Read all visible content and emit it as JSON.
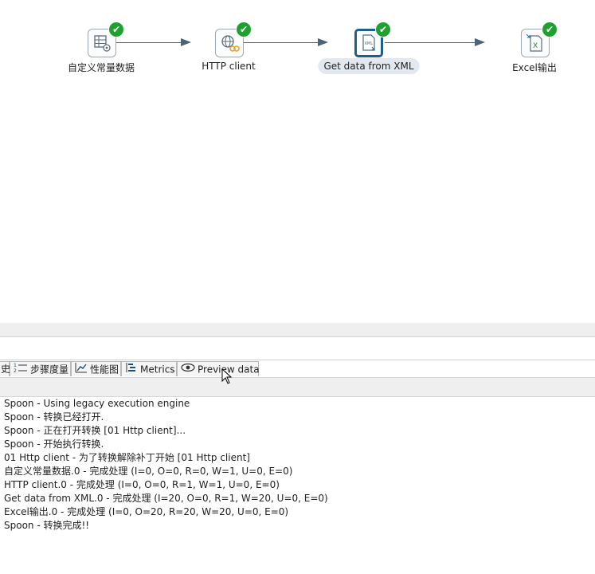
{
  "canvas": {
    "steps": [
      {
        "label": "自定义常量数据",
        "icon": "table-gear-icon"
      },
      {
        "label": "HTTP client",
        "icon": "globe-link-icon"
      },
      {
        "label": "Get data from XML",
        "icon": "xml-file-icon",
        "selected": true
      },
      {
        "label": "Excel输出",
        "icon": "excel-file-icon"
      }
    ],
    "status_icon": "check-icon",
    "colors": {
      "hop": "#4d6477",
      "check": "#1fa12f",
      "selected_border": "#1f5f8b"
    }
  },
  "tabs": {
    "partial_first": "史",
    "step_metrics": "步骤度量",
    "performance_graph": "性能图",
    "metrics": "Metrics",
    "preview_data": "Preview data"
  },
  "log": {
    "lines": [
      "Spoon - Using legacy execution engine",
      "Spoon - 转换已经打开.",
      "Spoon - 正在打开转换 [01 Http client]...",
      "Spoon - 开始执行转换.",
      "01 Http client - 为了转换解除补丁开始  [01 Http client]",
      "自定义常量数据.0 - 完成处理 (I=0, O=0, R=0, W=1, U=0, E=0)",
      "HTTP client.0 - 完成处理 (I=0, O=0, R=1, W=1, U=0, E=0)",
      "Get data from XML.0 - 完成处理 (I=20, O=0, R=1, W=20, U=0, E=0)",
      "Excel输出.0 - 完成处理 (I=0, O=20, R=20, W=20, U=0, E=0)",
      "Spoon - 转换完成!!"
    ]
  }
}
